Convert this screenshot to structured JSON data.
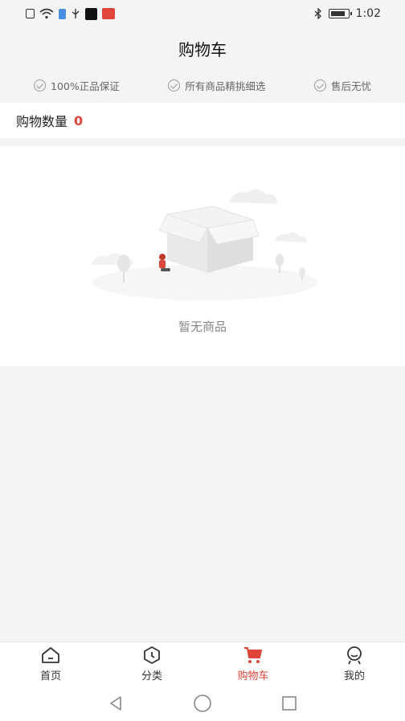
{
  "status_bar": {
    "time": "1:02"
  },
  "header": {
    "title": "购物车"
  },
  "guarantees": [
    {
      "label": "100%正品保证"
    },
    {
      "label": "所有商品精挑细选"
    },
    {
      "label": "售后无忧"
    }
  ],
  "cart": {
    "count_label": "购物数量",
    "count_value": "0"
  },
  "empty_state": {
    "text": "暂无商品"
  },
  "tabbar": {
    "items": [
      {
        "label": "首页",
        "icon": "home-icon"
      },
      {
        "label": "分类",
        "icon": "category-icon"
      },
      {
        "label": "购物车",
        "icon": "cart-icon",
        "active": true
      },
      {
        "label": "我的",
        "icon": "profile-icon"
      }
    ]
  },
  "colors": {
    "accent": "#e0443a",
    "background": "#f4f4f4"
  }
}
